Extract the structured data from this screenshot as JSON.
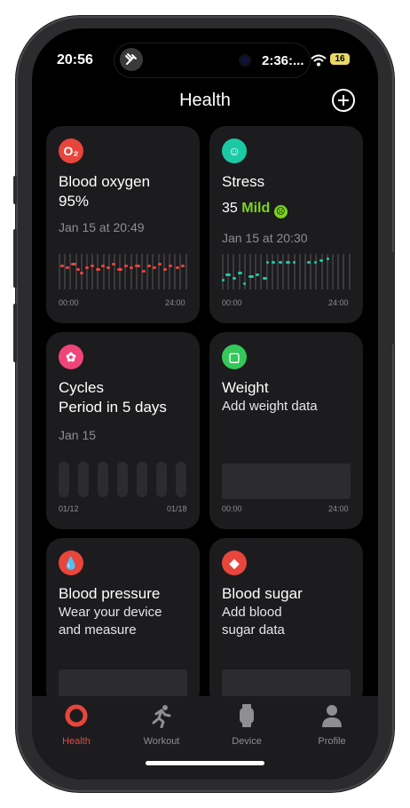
{
  "status": {
    "time": "20:56",
    "island_text": "2:36:...",
    "battery": "16"
  },
  "nav": {
    "title": "Health"
  },
  "cards": {
    "oxygen": {
      "title": "Blood oxygen",
      "value": "95%",
      "date": "Jan 15 at 20:49",
      "axis_start": "00:00",
      "axis_end": "24:00",
      "icon_color": "#e8453c"
    },
    "stress": {
      "title": "Stress",
      "value": "35",
      "level": "Mild",
      "date": "Jan 15 at 20:30",
      "axis_start": "00:00",
      "axis_end": "24:00",
      "icon_color": "#1cc9a5",
      "level_color": "#7ed321"
    },
    "cycles": {
      "title": "Cycles",
      "subtitle": "Period in 5 days",
      "date": "Jan 15",
      "axis_start": "01/12",
      "axis_end": "01/18",
      "icon_color": "#f0457a"
    },
    "weight": {
      "title": "Weight",
      "subtitle": "Add weight data",
      "axis_start": "00:00",
      "axis_end": "24:00",
      "icon_color": "#34c759"
    },
    "blood_pressure": {
      "title": "Blood pressure",
      "subtitle_line1": "Wear your device",
      "subtitle_line2": "and measure",
      "icon_color": "#e8453c"
    },
    "blood_sugar": {
      "title": "Blood sugar",
      "subtitle_line1": "Add blood",
      "subtitle_line2": "sugar data",
      "icon_color": "#e8453c"
    }
  },
  "tabs": [
    {
      "label": "Health",
      "icon": "health-ring-icon",
      "active": true
    },
    {
      "label": "Workout",
      "icon": "running-icon",
      "active": false
    },
    {
      "label": "Device",
      "icon": "watch-icon",
      "active": false
    },
    {
      "label": "Profile",
      "icon": "person-icon",
      "active": false
    }
  ],
  "colors": {
    "accent": "#e8453c",
    "inactive": "#8e8e93",
    "card": "#1c1c1e"
  }
}
